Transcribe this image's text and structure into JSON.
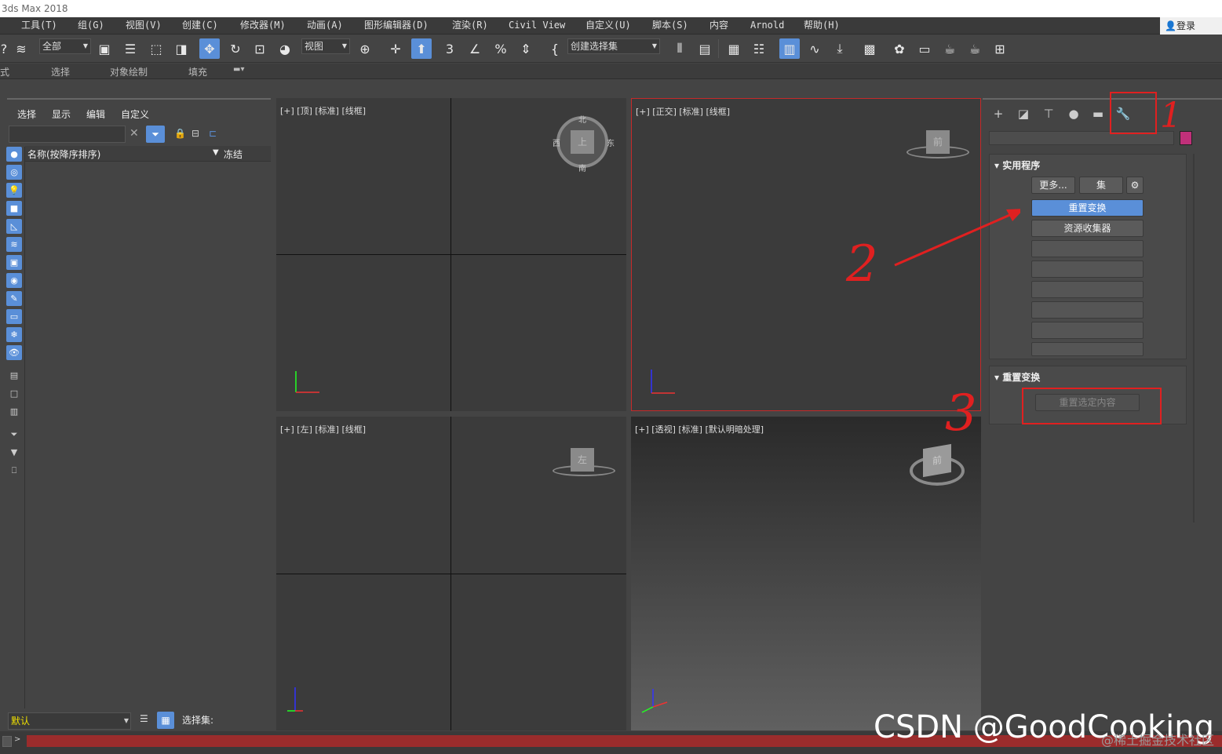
{
  "app": {
    "title": "3ds Max 2018"
  },
  "menubar": {
    "items": [
      "工具(T)",
      "组(G)",
      "视图(V)",
      "创建(C)",
      "修改器(M)",
      "动画(A)",
      "图形编辑器(D)",
      "渲染(R)",
      "Civil View",
      "自定义(U)",
      "脚本(S)",
      "内容",
      "Arnold",
      "帮助(H)"
    ],
    "login": "登录"
  },
  "toolbar": {
    "filter_dropdown": "全部",
    "ref_coord_dropdown": "视图",
    "selection_set_dropdown": "创建选择集"
  },
  "ribbon": {
    "items": [
      "式",
      "选择",
      "对象绘制",
      "填充"
    ]
  },
  "scene_explorer": {
    "tabs": [
      "选择",
      "显示",
      "编辑",
      "自定义"
    ],
    "column_name": "名称(按降序排序)",
    "column_frozen": "冻结"
  },
  "bottom_left": {
    "layer": "默认",
    "selection_set_label": "选择集:"
  },
  "viewports": {
    "top": {
      "label": "[+] [顶] [标准] [线框]",
      "cube": "上",
      "compass": [
        "北",
        "西",
        "东",
        "南"
      ]
    },
    "front": {
      "label": "[+] [正交] [标准] [线框]",
      "cube": "前"
    },
    "left": {
      "label": "[+] [左] [标准] [线框]",
      "cube": "左"
    },
    "persp": {
      "label": "[+] [透视] [标准] [默认明暗处理]",
      "cube": "前"
    }
  },
  "command_panel": {
    "utilities_rollout": {
      "title": "实用程序",
      "more": "更多...",
      "sets": "集",
      "reset_xform": "重置变换",
      "collector": "资源收集器"
    },
    "reset_xform_rollout": {
      "title": "重置变换",
      "reset_selected": "重置选定内容"
    }
  },
  "annotations": {
    "one": "1",
    "two": "2",
    "three": "3"
  },
  "watermark": {
    "main": "CSDN @GoodCooking",
    "sub": "@稀土掘金技术社区"
  },
  "colors": {
    "accent": "#5a8fd8",
    "annotation": "#e02020",
    "swatch": "#c0307a"
  }
}
